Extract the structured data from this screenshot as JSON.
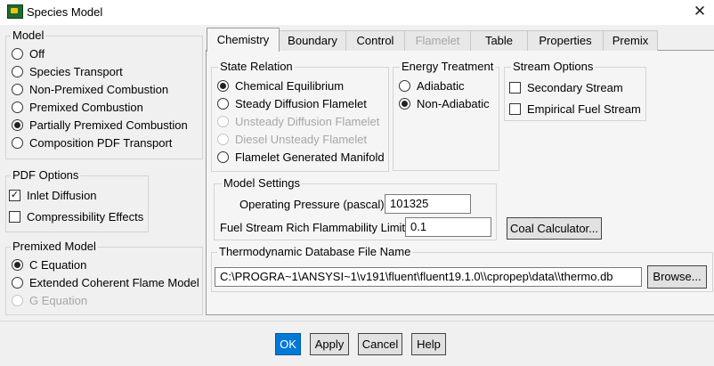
{
  "window": {
    "title": "Species Model",
    "close_glyph": "✕"
  },
  "model": {
    "label": "Model",
    "options": [
      "Off",
      "Species Transport",
      "Non-Premixed Combustion",
      "Premixed Combustion",
      "Partially Premixed Combustion",
      "Composition PDF Transport"
    ],
    "selected": "Partially Premixed Combustion"
  },
  "pdf_options": {
    "label": "PDF Options",
    "inlet_diffusion": "Inlet Diffusion",
    "compressibility": "Compressibility Effects"
  },
  "premixed_model": {
    "label": "Premixed Model",
    "options": [
      "C Equation",
      "Extended Coherent Flame Model",
      "G Equation"
    ],
    "selected": "C Equation"
  },
  "tabs": [
    "Chemistry",
    "Boundary",
    "Control",
    "Flamelet",
    "Table",
    "Properties",
    "Premix"
  ],
  "state_relation": {
    "label": "State Relation",
    "options": [
      "Chemical Equilibrium",
      "Steady Diffusion Flamelet",
      "Unsteady Diffusion Flamelet",
      "Diesel Unsteady Flamelet",
      "Flamelet Generated Manifold"
    ],
    "selected": "Chemical Equilibrium"
  },
  "energy_treatment": {
    "label": "Energy Treatment",
    "options": [
      "Adiabatic",
      "Non-Adiabatic"
    ],
    "selected": "Non-Adiabatic"
  },
  "stream_options": {
    "label": "Stream Options",
    "secondary": "Secondary Stream",
    "empirical": "Empirical Fuel Stream"
  },
  "model_settings": {
    "label": "Model Settings",
    "pressure_label": "Operating Pressure (pascal)",
    "pressure_value": "101325",
    "rich_limit_label": "Fuel Stream Rich Flammability Limit",
    "rich_limit_value": "0.1"
  },
  "coal_calculator": "Coal Calculator...",
  "thermo_db": {
    "label": "Thermodynamic Database File Name",
    "path": "C:\\PROGRA~1\\ANSYSI~1\\v191\\fluent\\fluent19.1.0\\\\cpropep\\data\\\\thermo.db",
    "browse": "Browse..."
  },
  "buttons": {
    "ok": "OK",
    "apply": "Apply",
    "cancel": "Cancel",
    "help": "Help"
  }
}
